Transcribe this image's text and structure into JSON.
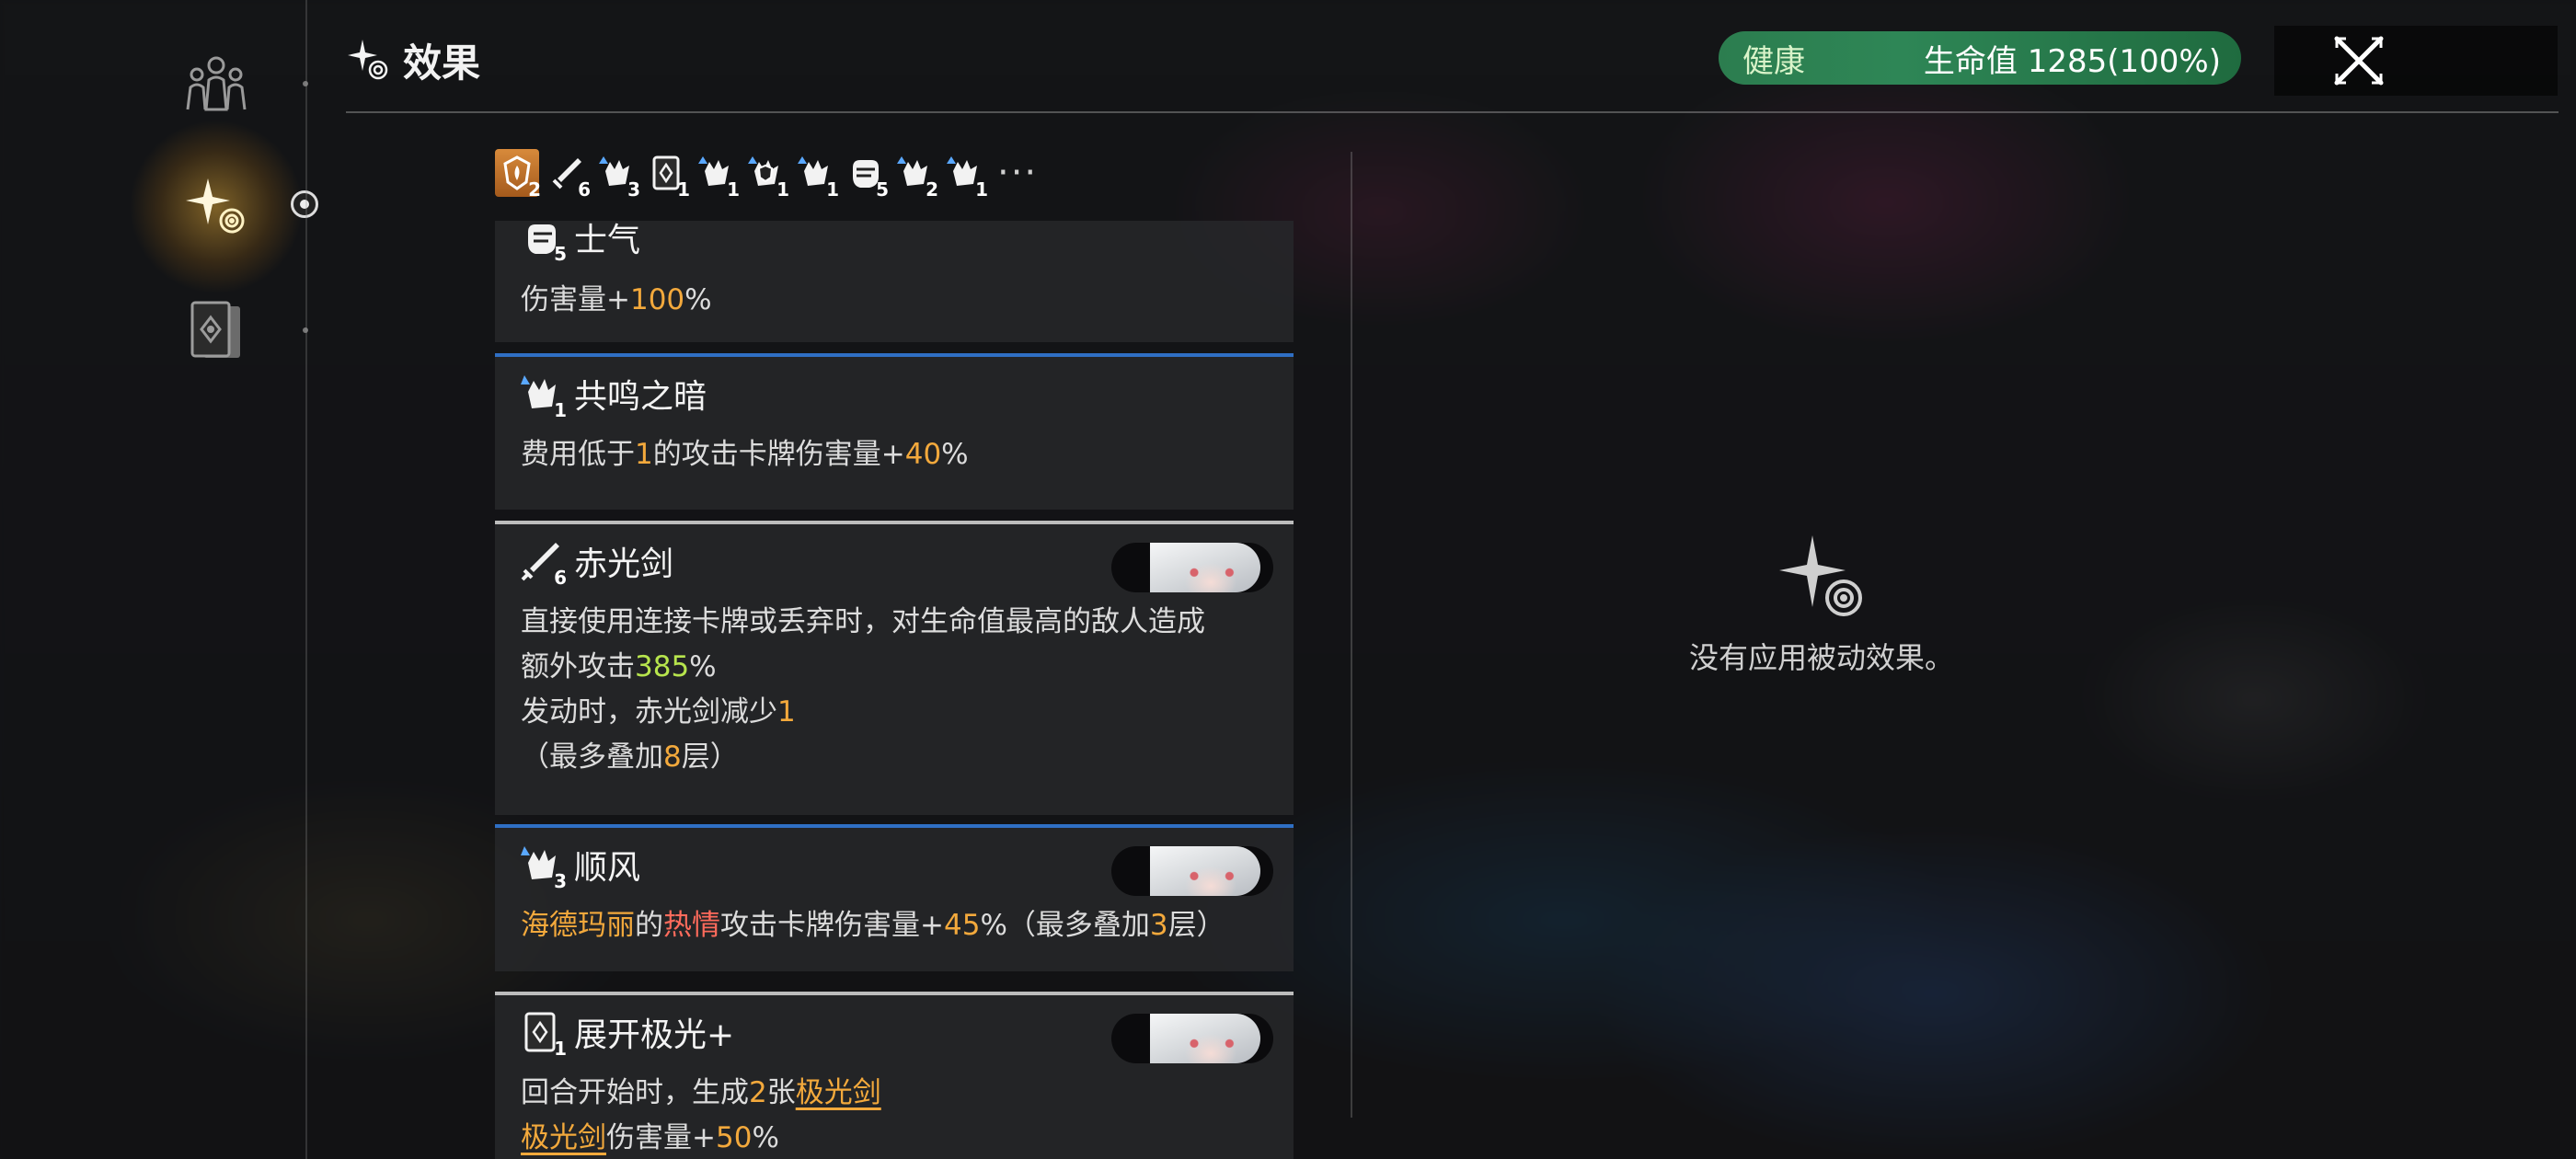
{
  "header": {
    "title": "效果"
  },
  "health": {
    "status": "健康",
    "hp_label": "生命值 1285(100%)"
  },
  "nav": {
    "items": [
      "characters-icon",
      "effects-icon",
      "cards-icon"
    ]
  },
  "strip": {
    "icons": [
      {
        "icon": "flame-shield-icon",
        "count": "2"
      },
      {
        "icon": "sword-icon",
        "count": "6"
      },
      {
        "icon": "hand-buff-icon",
        "count": "3"
      },
      {
        "icon": "card-icon",
        "count": "1"
      },
      {
        "icon": "hand-buff-icon",
        "count": "1"
      },
      {
        "icon": "hand-shield-icon",
        "count": "1"
      },
      {
        "icon": "hand-buff-icon",
        "count": "1"
      },
      {
        "icon": "fist-icon",
        "count": "5"
      },
      {
        "icon": "hand-buff-icon",
        "count": "2"
      },
      {
        "icon": "hand-buff-icon",
        "count": "1"
      }
    ],
    "more": "···"
  },
  "effects": [
    {
      "title": "士气",
      "count": "5",
      "lines": [
        [
          "伤害量+",
          {
            "n": "100"
          },
          "%"
        ]
      ]
    },
    {
      "title": "共鸣之暗",
      "count": "1",
      "lines": [
        [
          "费用低于",
          {
            "n": "1"
          },
          "的攻击卡牌伤害量+",
          {
            "n": "40"
          },
          "%"
        ]
      ]
    },
    {
      "title": "赤光剑",
      "count": "6",
      "lines": [
        [
          "直接使用连接卡牌或丢弃时，对生命值最高的敌人造成"
        ],
        [
          "额外攻击",
          {
            "g": "385"
          },
          "%"
        ],
        [
          "发动时，赤光剑减少",
          {
            "n": "1"
          }
        ],
        [
          "（最多叠加",
          {
            "n": "8"
          },
          "层）"
        ]
      ]
    },
    {
      "title": "顺风",
      "count": "3",
      "lines": [
        [
          {
            "o": "海德玛丽"
          },
          "的",
          {
            "r": "热情"
          },
          "攻击卡牌伤害量+",
          {
            "n": "45"
          },
          "%（最多叠加",
          {
            "n": "3"
          },
          "层）"
        ]
      ]
    },
    {
      "title": "展开极光+",
      "count": "1",
      "lines": [
        [
          "回合开始时，生成",
          {
            "n": "2"
          },
          "张",
          {
            "u": "极光剑"
          }
        ],
        [
          {
            "u": "极光剑"
          },
          "伤害量+",
          {
            "n": "50"
          },
          "%"
        ]
      ]
    }
  ],
  "empty_state": {
    "text": "没有应用被动效果。"
  },
  "colors": {
    "accent_orange": "#f3a93c",
    "health_green": "#2e8656",
    "divider_blue": "#2f6fc4"
  }
}
